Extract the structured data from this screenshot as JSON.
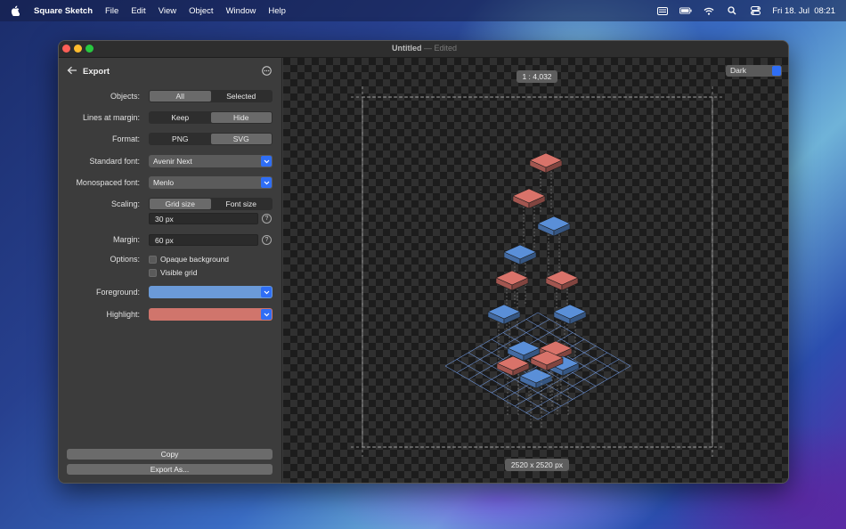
{
  "menubar": {
    "app_name": "Square Sketch",
    "menus": [
      "File",
      "Edit",
      "View",
      "Object",
      "Window",
      "Help"
    ],
    "clock": "Fri 18. Jul  08:21"
  },
  "window": {
    "title": "Untitled",
    "separator": "—",
    "status": "Edited"
  },
  "sidebar": {
    "title": "Export",
    "objects": {
      "label": "Objects:",
      "options": [
        "All",
        "Selected"
      ],
      "selected": "All"
    },
    "lines_at_margin": {
      "label": "Lines at margin:",
      "options": [
        "Keep",
        "Hide"
      ],
      "selected": "Hide"
    },
    "format": {
      "label": "Format:",
      "options": [
        "PNG",
        "SVG"
      ],
      "selected": "SVG"
    },
    "standard_font": {
      "label": "Standard font:",
      "value": "Avenir Next"
    },
    "mono_font": {
      "label": "Monospaced font:",
      "value": "Menlo"
    },
    "scaling": {
      "label": "Scaling:",
      "options": [
        "Grid size",
        "Font size"
      ],
      "selected": "Grid size",
      "value": "30 px"
    },
    "margin": {
      "label": "Margin:",
      "value": "60 px"
    },
    "options": {
      "label": "Options:",
      "opaque_background": "Opaque background",
      "visible_grid": "Visible grid"
    },
    "foreground": {
      "label": "Foreground:",
      "color": "#6b9ad8"
    },
    "highlight": {
      "label": "Highlight:",
      "color": "#d0756c"
    },
    "copy_label": "Copy",
    "export_label": "Export As...",
    "help_glyph": "?"
  },
  "canvas": {
    "scale": "1 : 4,032",
    "size": "2520 x 2520 px",
    "theme": "Dark",
    "blue": "#5a8fd8",
    "red": "#d9736a"
  }
}
